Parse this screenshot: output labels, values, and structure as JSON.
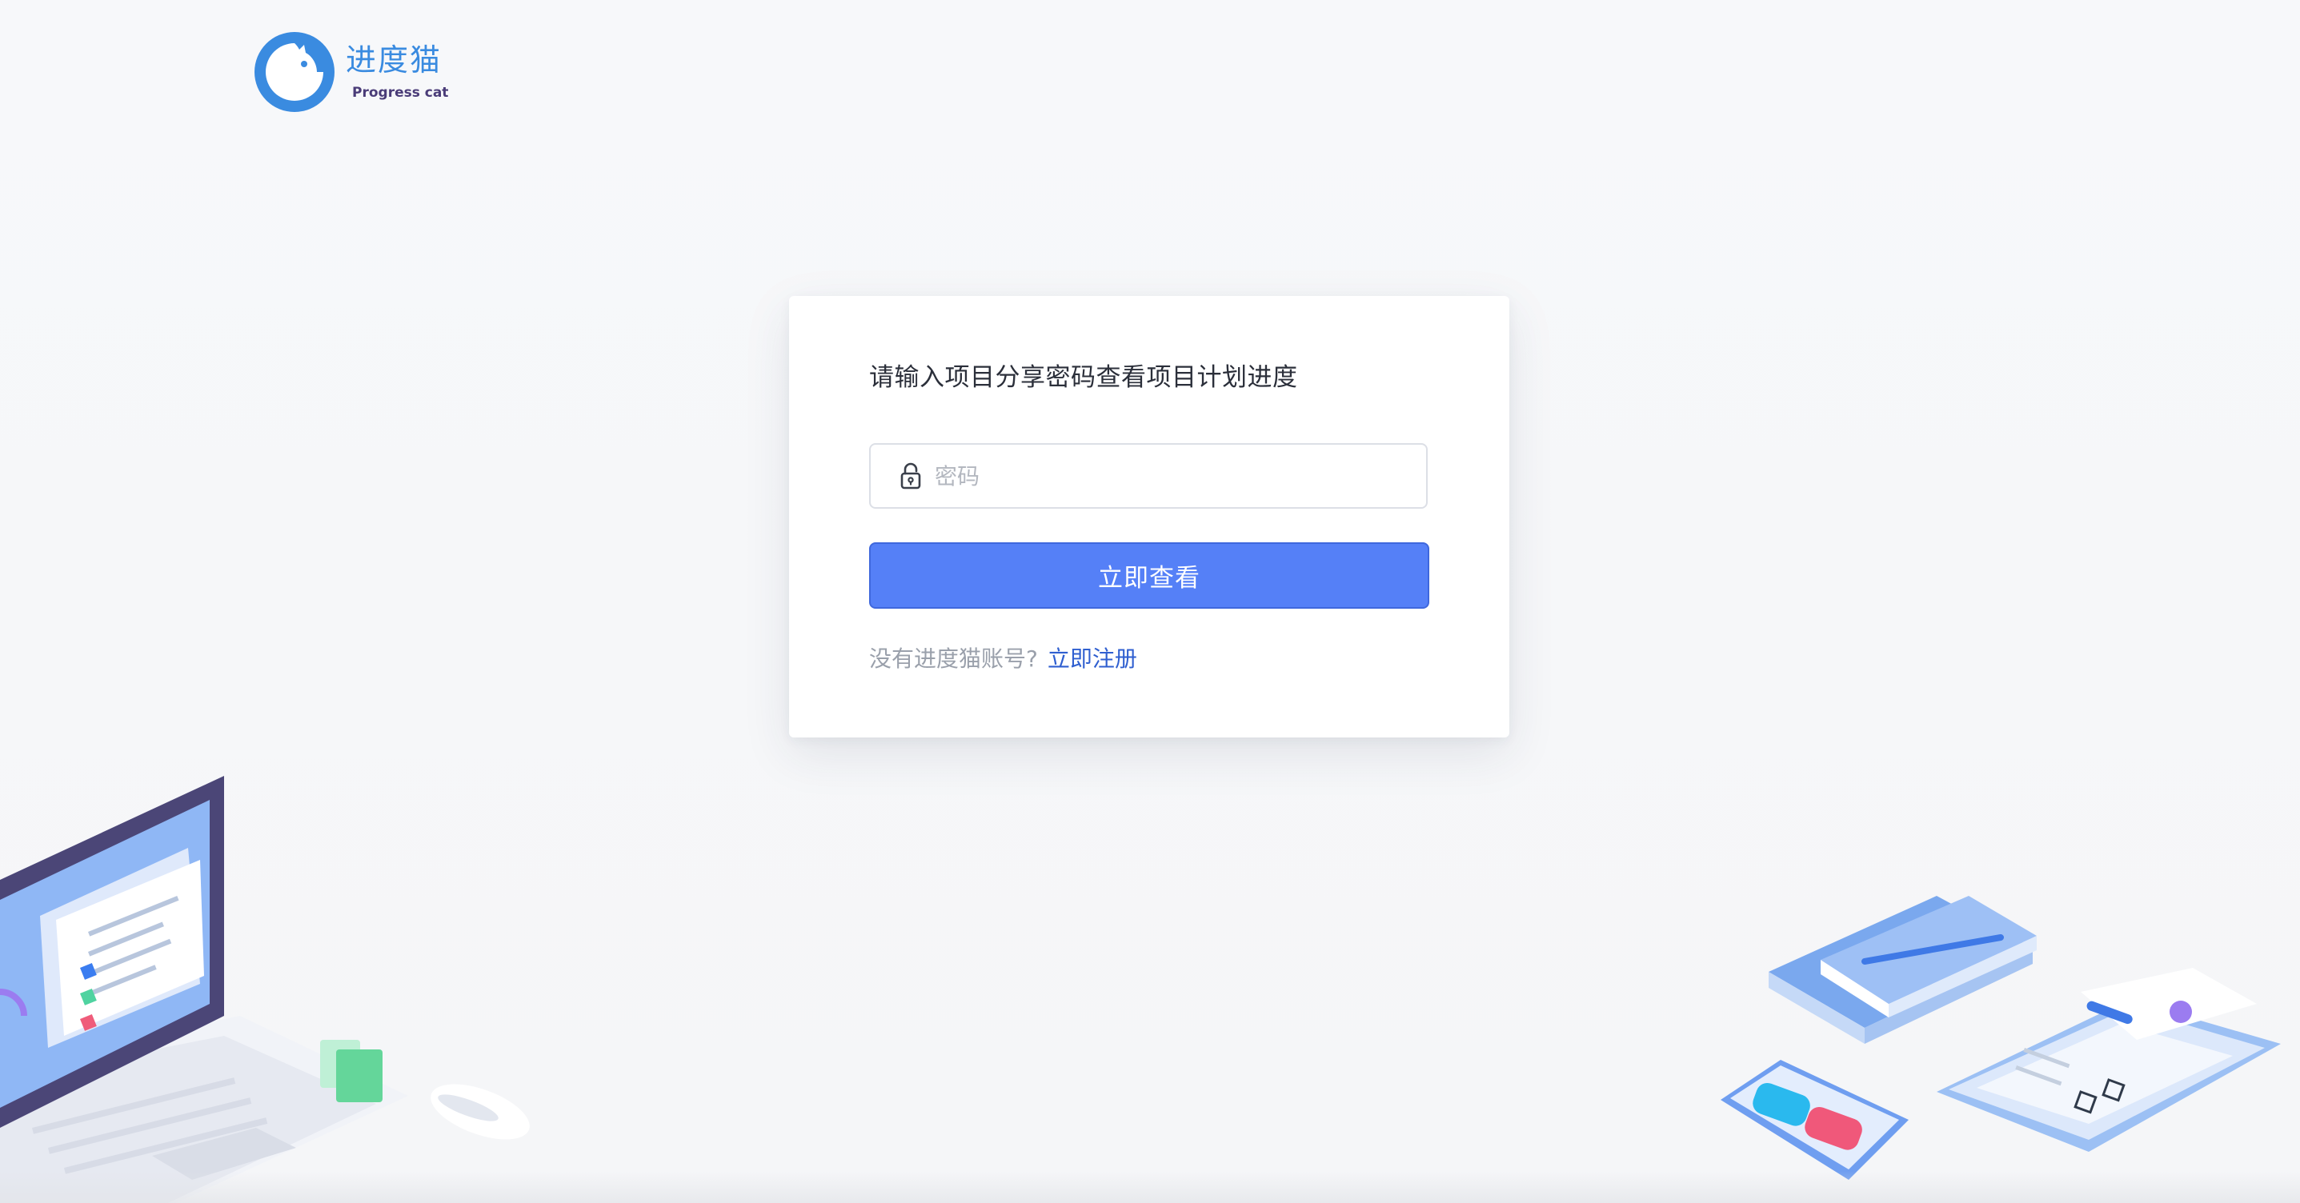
{
  "logo": {
    "cn": "进度猫",
    "en": "Progress cat"
  },
  "card": {
    "title": "请输入项目分享密码查看项目计划进度",
    "password": {
      "value": "",
      "placeholder": "密码"
    },
    "submit_label": "立即查看",
    "register_prompt": "没有进度猫账号?",
    "register_link": "立即注册"
  },
  "icons": {
    "lock": "lock-icon",
    "logo": "cat-logo-icon"
  },
  "colors": {
    "primary": "#5580f7",
    "link": "#2f5fd0",
    "logo_blue": "#3a8be0"
  }
}
